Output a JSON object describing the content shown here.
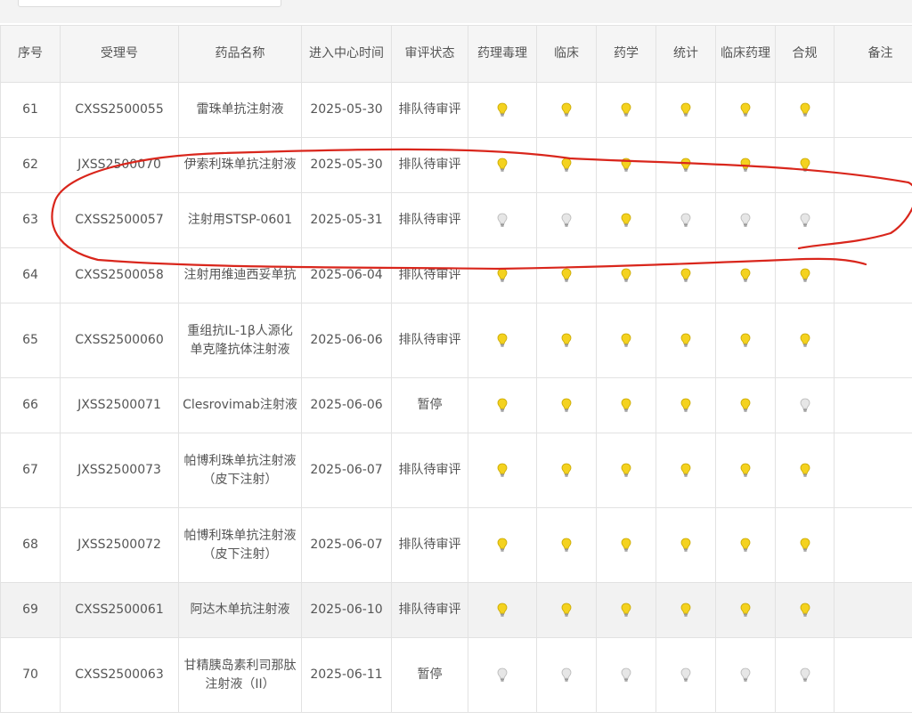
{
  "table": {
    "columns": [
      "序号",
      "受理号",
      "药品名称",
      "进入中心时间",
      "审评状态",
      "药理毒理",
      "临床",
      "药学",
      "统计",
      "临床药理",
      "合规",
      "备注"
    ],
    "rows": [
      {
        "no": "61",
        "accept_no": "CXSS2500055",
        "drug": "雷珠单抗注射液",
        "date": "2025-05-30",
        "status": "排队待审评",
        "bulbs": [
          "on",
          "on",
          "on",
          "on",
          "on",
          "on"
        ],
        "note": ""
      },
      {
        "no": "62",
        "accept_no": "JXSS2500070",
        "drug": "伊索利珠单抗注射液",
        "date": "2025-05-30",
        "status": "排队待审评",
        "bulbs": [
          "on",
          "on",
          "on",
          "on",
          "on",
          "on"
        ],
        "note": ""
      },
      {
        "no": "63",
        "accept_no": "CXSS2500057",
        "drug": "注射用STSP-0601",
        "date": "2025-05-31",
        "status": "排队待审评",
        "bulbs": [
          "off",
          "off",
          "on",
          "off",
          "off",
          "off"
        ],
        "note": ""
      },
      {
        "no": "64",
        "accept_no": "CXSS2500058",
        "drug": "注射用维迪西妥单抗",
        "date": "2025-06-04",
        "status": "排队待审评",
        "bulbs": [
          "on",
          "on",
          "on",
          "on",
          "on",
          "on"
        ],
        "note": ""
      },
      {
        "no": "65",
        "accept_no": "CXSS2500060",
        "drug": "重组抗IL-1β人源化单克隆抗体注射液",
        "date": "2025-06-06",
        "status": "排队待审评",
        "bulbs": [
          "on",
          "on",
          "on",
          "on",
          "on",
          "on"
        ],
        "note": ""
      },
      {
        "no": "66",
        "accept_no": "JXSS2500071",
        "drug": "Clesrovimab注射液",
        "date": "2025-06-06",
        "status": "暂停",
        "bulbs": [
          "on",
          "on",
          "on",
          "on",
          "on",
          "off"
        ],
        "note": ""
      },
      {
        "no": "67",
        "accept_no": "JXSS2500073",
        "drug": "帕博利珠单抗注射液（皮下注射）",
        "date": "2025-06-07",
        "status": "排队待审评",
        "bulbs": [
          "on",
          "on",
          "on",
          "on",
          "on",
          "on"
        ],
        "note": ""
      },
      {
        "no": "68",
        "accept_no": "JXSS2500072",
        "drug": "帕博利珠单抗注射液（皮下注射）",
        "date": "2025-06-07",
        "status": "排队待审评",
        "bulbs": [
          "on",
          "on",
          "on",
          "on",
          "on",
          "on"
        ],
        "note": ""
      },
      {
        "no": "69",
        "accept_no": "CXSS2500061",
        "drug": "阿达木单抗注射液",
        "date": "2025-06-10",
        "status": "排队待审评",
        "bulbs": [
          "on",
          "on",
          "on",
          "on",
          "on",
          "on"
        ],
        "note": ""
      },
      {
        "no": "70",
        "accept_no": "CXSS2500063",
        "drug": "甘精胰岛素利司那肽注射液（II）",
        "date": "2025-06-11",
        "status": "暂停",
        "bulbs": [
          "off",
          "off",
          "off",
          "off",
          "off",
          "off"
        ],
        "note": ""
      }
    ]
  },
  "colors": {
    "bulb_on": "#f4d21f",
    "bulb_off": "#e6e6e6",
    "annotation": "#d9261c"
  }
}
